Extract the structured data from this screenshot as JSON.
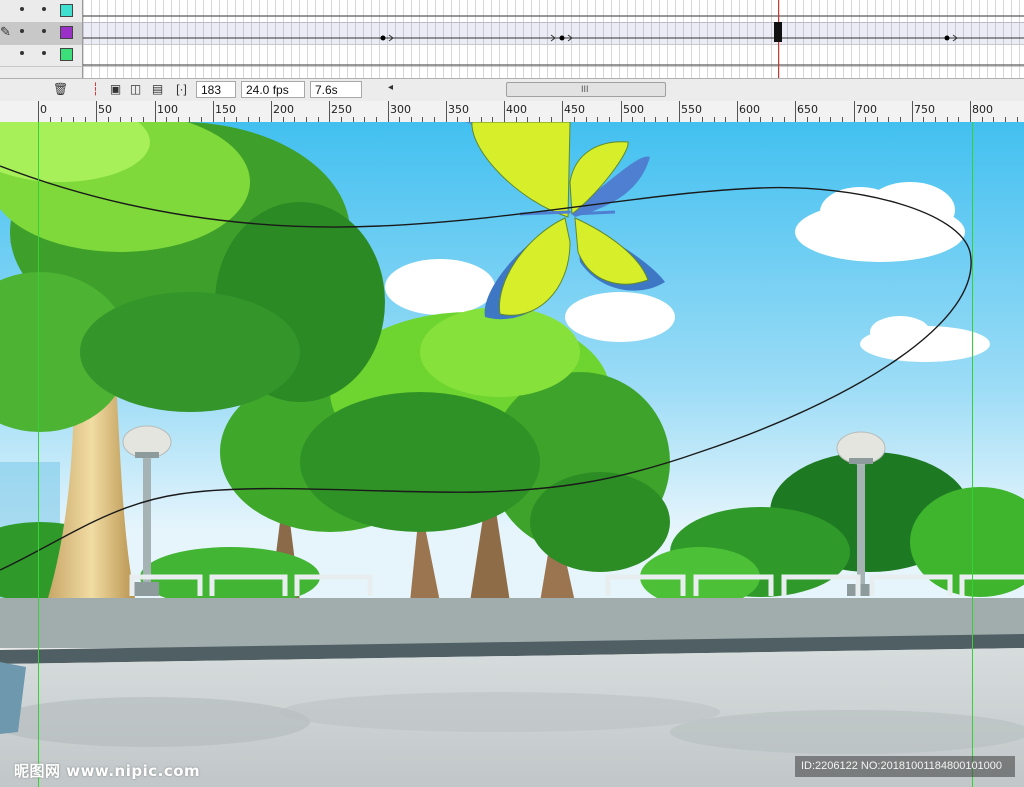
{
  "timeline": {
    "layers": [
      {
        "color": "#40e0d0",
        "selected": false
      },
      {
        "color": "#9b30c8",
        "selected": true
      },
      {
        "color": "#3ce07a",
        "selected": false
      }
    ],
    "current_frame": "183",
    "frame_rate": "24.0 fps",
    "elapsed_time": "7.6s"
  },
  "toolbar": {
    "delete_icon": "trash-icon",
    "center_frame_icon": "center-frame-icon",
    "onion_skin_icon": "onion-skin-icon",
    "onion_outline_icon": "onion-skin-outlines-icon",
    "edit_multiple_icon": "edit-multiple-frames-icon",
    "onion_markers_icon": "modify-onion-markers-icon",
    "scroll_left_icon": "scroll-left-arrow-icon",
    "scroll_grip": "III"
  },
  "ruler": {
    "labels": [
      "0",
      "50",
      "100",
      "150",
      "200",
      "250",
      "300",
      "350",
      "400",
      "450",
      "500",
      "550",
      "600",
      "650",
      "700",
      "750",
      "800"
    ]
  },
  "stage": {
    "description_icons": [
      "tree-icon",
      "butterfly-icon",
      "lamp-post-icon",
      "cloud-icon",
      "railing-icon"
    ],
    "sky_top": "#49c4f0",
    "sky_bottom": "#e6f5fc"
  },
  "watermark": {
    "text": "昵图网 www.nipic.com",
    "id_text": "ID:2206122 NO:20181001184800101000"
  }
}
